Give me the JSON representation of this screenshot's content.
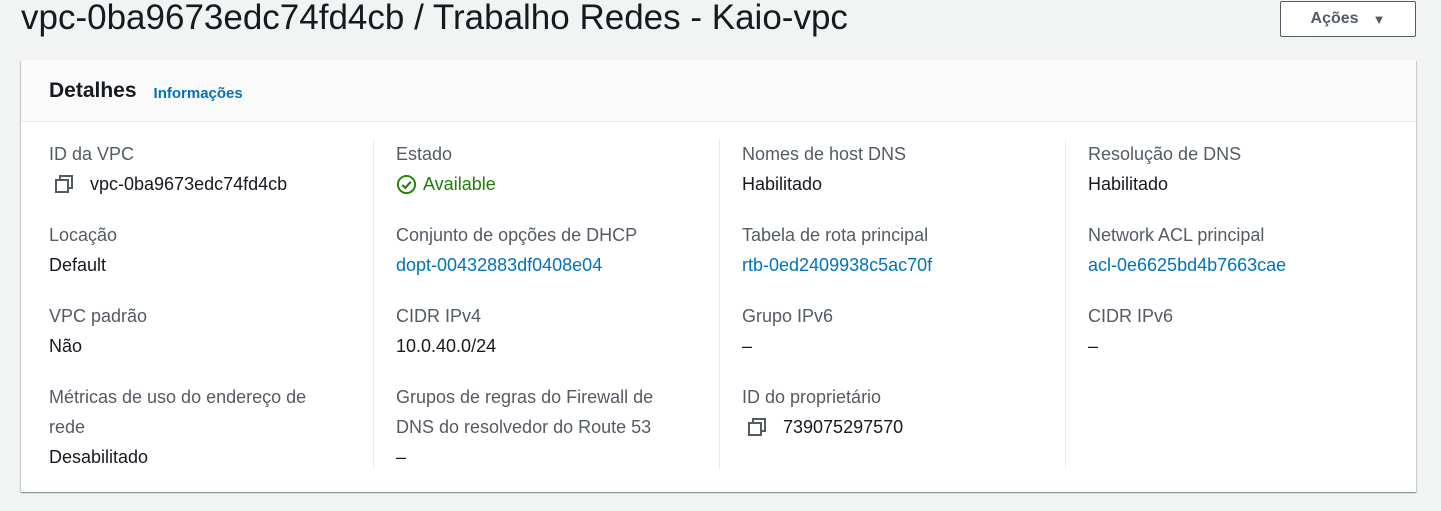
{
  "header": {
    "title": "vpc-0ba9673edc74fd4cb / Trabalho Redes - Kaio-vpc",
    "actions_label": "Ações"
  },
  "panel": {
    "title": "Detalhes",
    "info_link": "Informações"
  },
  "fields": {
    "vpc_id": {
      "label": "ID da VPC",
      "value": "vpc-0ba9673edc74fd4cb"
    },
    "locacao": {
      "label": "Locação",
      "value": "Default"
    },
    "vpc_padrao": {
      "label": "VPC padrão",
      "value": "Não"
    },
    "metricas": {
      "label_line1": "Métricas de uso do endereço de",
      "label_line2": "rede",
      "value": "Desabilitado"
    },
    "estado": {
      "label": "Estado",
      "value": "Available"
    },
    "dhcp": {
      "label": "Conjunto de opções de DHCP",
      "value": "dopt-00432883df0408e04"
    },
    "cidr_ipv4": {
      "label": "CIDR IPv4",
      "value": "10.0.40.0/24"
    },
    "firewall_dns": {
      "label_line1": "Grupos de regras do Firewall de",
      "label_line2": "DNS do resolvedor do Route 53",
      "value": "–"
    },
    "dns_hostnames": {
      "label": "Nomes de host DNS",
      "value": "Habilitado"
    },
    "rota_principal": {
      "label": "Tabela de rota principal",
      "value": "rtb-0ed2409938c5ac70f"
    },
    "grupo_ipv6": {
      "label": "Grupo IPv6",
      "value": "–"
    },
    "owner_id": {
      "label": "ID do proprietário",
      "value": "739075297570"
    },
    "dns_resolution": {
      "label": "Resolução de DNS",
      "value": "Habilitado"
    },
    "network_acl": {
      "label": "Network ACL principal",
      "value": "acl-0e6625bd4b7663cae"
    },
    "cidr_ipv6": {
      "label": "CIDR IPv6",
      "value": "–"
    }
  },
  "icons": {
    "copy": "copy-icon",
    "status_ok": "status-positive-icon",
    "caret": "caret-down-icon"
  },
  "colors": {
    "link": "#0073bb",
    "success": "#1d8102",
    "label": "#545b64"
  }
}
